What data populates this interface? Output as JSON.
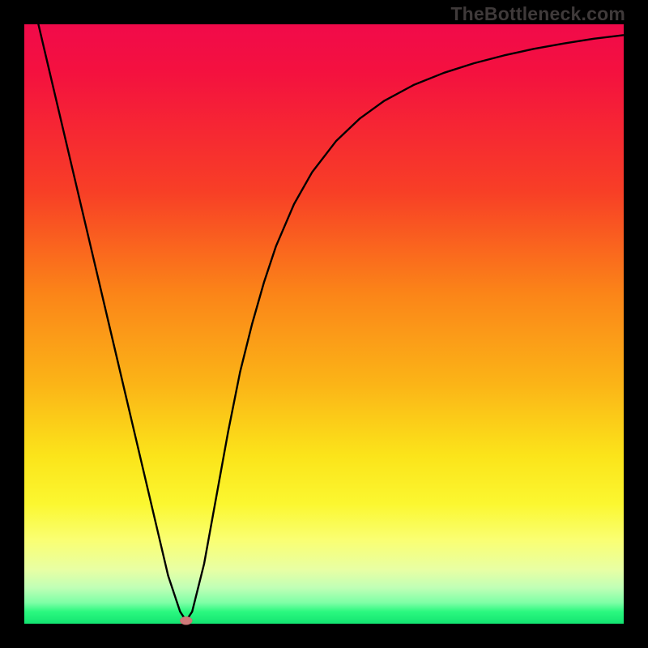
{
  "watermark": "TheBottleneck.com",
  "chart_data": {
    "type": "line",
    "title": "",
    "xlabel": "",
    "ylabel": "",
    "xlim": [
      0,
      100
    ],
    "ylim": [
      0,
      100
    ],
    "grid": false,
    "legend": false,
    "series": [
      {
        "name": "bottleneck-curve",
        "x": [
          0,
          2,
          4,
          6,
          8,
          10,
          12,
          14,
          16,
          18,
          20,
          22,
          24,
          26,
          27,
          28,
          30,
          32,
          34,
          36,
          38,
          40,
          42,
          45,
          48,
          52,
          56,
          60,
          65,
          70,
          75,
          80,
          85,
          90,
          95,
          100
        ],
        "values": [
          110,
          101.5,
          93,
          84.5,
          76,
          67.5,
          59,
          50.5,
          42,
          33.5,
          25,
          16.5,
          8,
          2,
          0.5,
          2,
          10,
          21,
          32,
          42,
          50,
          57,
          63,
          70,
          75.3,
          80.5,
          84.3,
          87.2,
          89.9,
          91.9,
          93.5,
          94.8,
          95.9,
          96.8,
          97.6,
          98.2
        ]
      }
    ],
    "markers": [
      {
        "name": "optimal-point",
        "x": 27,
        "y": 0.5
      }
    ],
    "background_gradient": {
      "orientation": "vertical",
      "stops": [
        {
          "pos": 0.0,
          "color": "#f10a4a"
        },
        {
          "pos": 0.28,
          "color": "#f83f26"
        },
        {
          "pos": 0.6,
          "color": "#fbb417"
        },
        {
          "pos": 0.8,
          "color": "#fbf730"
        },
        {
          "pos": 0.94,
          "color": "#c0ffb6"
        },
        {
          "pos": 1.0,
          "color": "#13e471"
        }
      ]
    }
  }
}
